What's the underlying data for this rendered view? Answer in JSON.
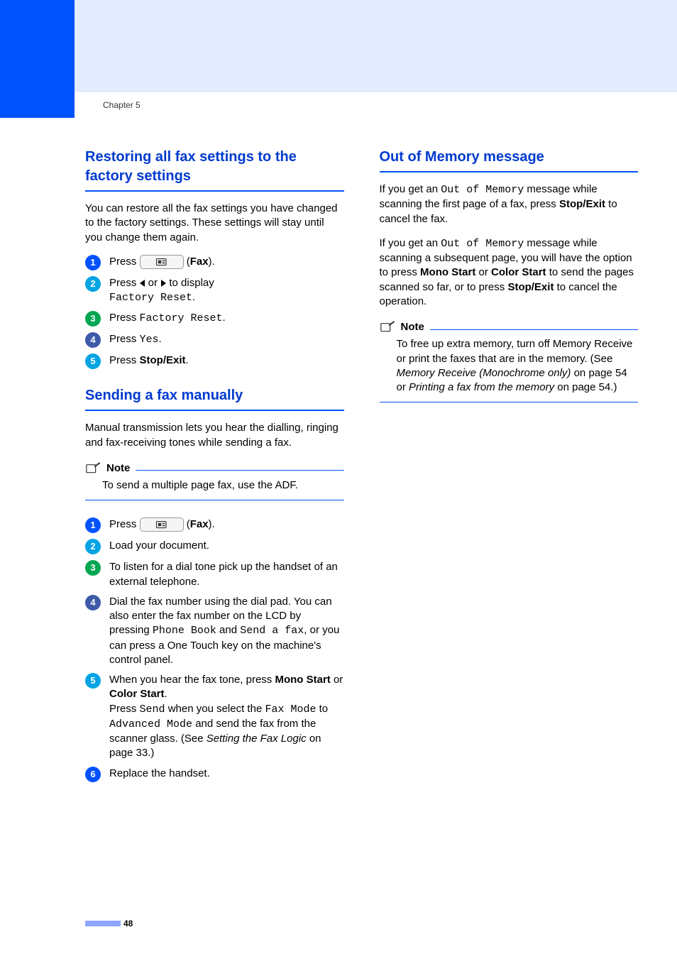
{
  "chapter_label": "Chapter 5",
  "page_number": "48",
  "left": {
    "sec1": {
      "title": "Restoring all fax settings to the factory settings",
      "intro": "You can restore all the fax settings you have changed to the factory settings. These settings will stay until you change them again.",
      "step1_press": "Press ",
      "step1_fax_open": " (",
      "step1_fax": "Fax",
      "step1_fax_close": ").",
      "step2_pre": "Press ",
      "step2_mid": " or ",
      "step2_post": " to display ",
      "step2_code": "Factory Reset",
      "step2_end": ".",
      "step3_pre": "Press ",
      "step3_code": "Factory Reset",
      "step3_end": ".",
      "step4_pre": "Press ",
      "step4_code": "Yes",
      "step4_end": ".",
      "step5_pre": "Press ",
      "step5_bold": "Stop/Exit",
      "step5_end": "."
    },
    "sec2": {
      "title": "Sending a fax manually",
      "intro": "Manual transmission lets you hear the dialling, ringing and fax-receiving tones while sending a fax.",
      "note_title": "Note",
      "note_text": "To send a multiple page fax, use the ADF.",
      "step1_press": "Press ",
      "step1_fax_open": " (",
      "step1_fax": "Fax",
      "step1_fax_close": ").",
      "step2": "Load your document.",
      "step3": "To listen for a dial tone pick up the handset of an external telephone.",
      "step4_l1": "Dial the fax number using the dial pad. You can also enter the fax number on the LCD by pressing ",
      "step4_code1": "Phone Book",
      "step4_l2": " and ",
      "step4_code2": "Send a fax",
      "step4_l3": ", or you can press a One Touch key on the machine's control panel.",
      "step5_l1": "When you hear the fax tone, press ",
      "step5_b1": "Mono Start",
      "step5_l2": " or ",
      "step5_b2": "Color Start",
      "step5_l3": ".",
      "step5_l4_pre": "Press ",
      "step5_code1": "Send",
      "step5_l4_mid": " when you select the ",
      "step5_code2": "Fax Mode",
      "step5_l4_to": " to ",
      "step5_code3": "Advanced Mode",
      "step5_l4_post": " and send the fax from the scanner glass. (See ",
      "step5_italic": "Setting the Fax Logic",
      "step5_l4_end": " on page 33.)",
      "step6": "Replace the handset."
    }
  },
  "right": {
    "sec1": {
      "title": "Out of Memory message",
      "p1_pre": "If you get an ",
      "p1_code": "Out of Memory",
      "p1_mid": " message while scanning the first page of a fax, press ",
      "p1_bold": "Stop/Exit",
      "p1_post": " to cancel the fax.",
      "p2_pre": "If you get an ",
      "p2_code": "Out of Memory",
      "p2_mid": " message while scanning a subsequent page, you will have the option to press ",
      "p2_b1": "Mono Start",
      "p2_or": " or ",
      "p2_b2": "Color Start",
      "p2_mid2": " to send the pages scanned so far, or to press ",
      "p2_b3": "Stop/Exit",
      "p2_post": " to cancel the operation.",
      "note_title": "Note",
      "note_l1": "To free up extra memory, turn off Memory Receive or print the faxes that are in the memory. (See ",
      "note_i1": "Memory Receive (Monochrome only)",
      "note_l2": " on page 54 or ",
      "note_i2": "Printing a fax from the memory",
      "note_l3": " on page 54.)"
    }
  }
}
